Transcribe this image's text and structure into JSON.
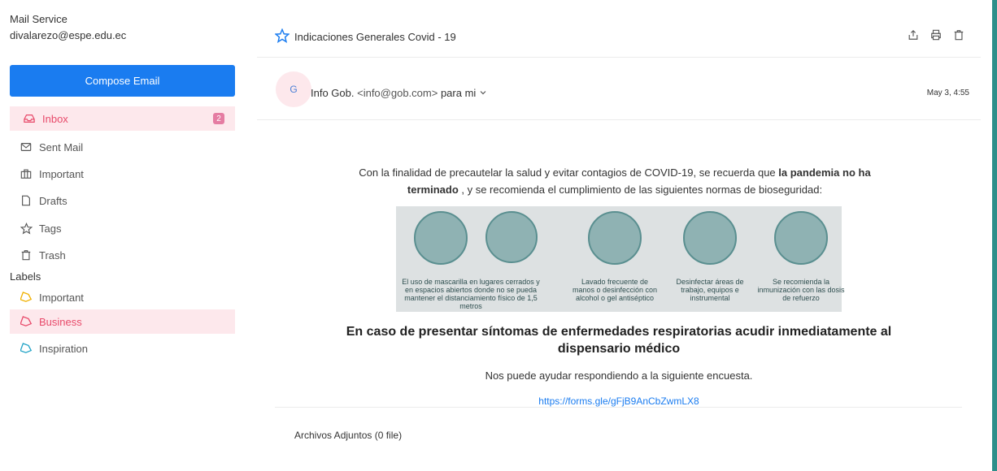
{
  "app": {
    "title": "Mail Service",
    "account": "divalarezo@espe.edu.ec"
  },
  "compose": {
    "label": "Compose Email"
  },
  "nav": [
    {
      "label": "Inbox",
      "icon": "inbox-icon",
      "badge": "2"
    },
    {
      "label": "Sent Mail",
      "icon": "mail-icon"
    },
    {
      "label": "Important",
      "icon": "briefcase-icon"
    },
    {
      "label": "Drafts",
      "icon": "file-icon"
    },
    {
      "label": "Tags",
      "icon": "star-icon"
    },
    {
      "label": "Trash",
      "icon": "trash-icon"
    }
  ],
  "labels": {
    "title": "Labels",
    "items": [
      {
        "label": "Important",
        "color": "#f0b000"
      },
      {
        "label": "Business",
        "color": "#e84a6a"
      },
      {
        "label": "Inspiration",
        "color": "#21a3c6"
      }
    ]
  },
  "email": {
    "subject": "Indicaciones Generales Covid - 19",
    "avatar": "G",
    "sender_name": "Info Gob.",
    "sender_email": "<info@gob.com>",
    "recipient": "para mi",
    "date": "May 3, 4:55",
    "intro_pre": "Con la finalidad de precautelar la salud y evitar contagios de COVID-19, se recuerda que ",
    "intro_bold": "la pandemia no ha terminado",
    "intro_post": " , y se recomienda el cumplimiento de las siguientes normas de bioseguridad:",
    "infographic": [
      "El uso de mascarilla en lugares cerrados y en espacios abiertos donde no se pueda mantener el distanciamiento físico de 1,5 metros",
      "Lavado frecuente de manos o desinfección con alcohol o gel antiséptico",
      "Desinfectar áreas de trabajo, equipos e instrumental",
      "Se recomienda la inmunización con las dosis de refuerzo"
    ],
    "headline": "En caso de presentar síntomas de enfermedades respiratorias acudir inmediatamente al dispensario médico",
    "ask": "Nos puede ayudar respondiendo a la siguiente encuesta.",
    "link": "https://forms.gle/gFjB9AnCbZwmLX8",
    "attachments": "Archivos Adjuntos (0 file)"
  },
  "colors": {
    "accent": "#1a7cf0",
    "active_bg": "#fde8ec",
    "active_text": "#e84a6a",
    "badge": "#e57ca2"
  }
}
